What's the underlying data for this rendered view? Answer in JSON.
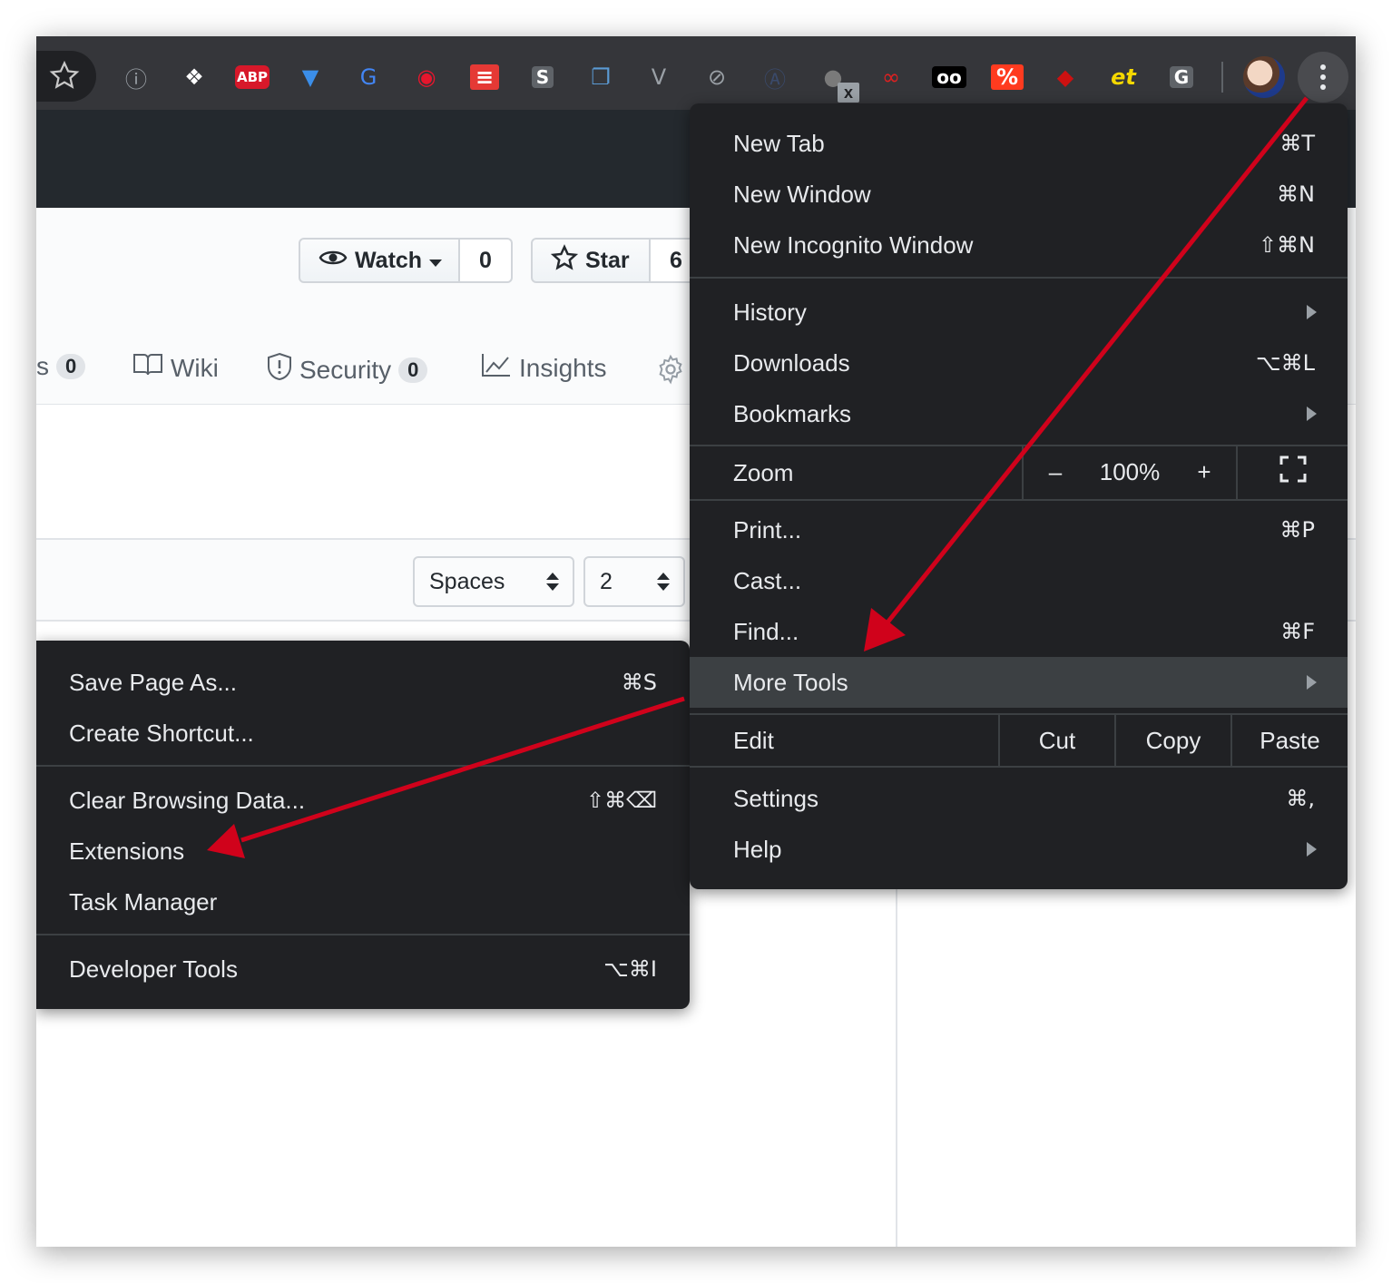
{
  "repo": {
    "watch_label": "Watch",
    "watch_count": "0",
    "star_label": "Star",
    "star_count": "6",
    "tabs": [
      {
        "label": "s",
        "count": "0"
      },
      {
        "label": "Wiki"
      },
      {
        "label": "Security",
        "count": "0"
      },
      {
        "label": "Insights"
      }
    ],
    "indent_mode": "Spaces",
    "indent_size": "2"
  },
  "toolbar": {
    "extensions": [
      {
        "icon": "info-circle-icon",
        "glyph": "ⓘ",
        "color": "#9aa0a6"
      },
      {
        "icon": "diamond-grid-icon",
        "glyph": "❖",
        "color": "#ffffff"
      },
      {
        "icon": "abp-icon",
        "glyph": "ABP",
        "color": "#d7182a"
      },
      {
        "icon": "gem-shield-icon",
        "glyph": "▼",
        "color": "#3b8ee8"
      },
      {
        "icon": "translate-icon",
        "glyph": "G",
        "color": "#4285f4"
      },
      {
        "icon": "weibo-icon",
        "glyph": "◉",
        "color": "#e6162d"
      },
      {
        "icon": "red-notes-icon",
        "glyph": "≡",
        "color": "#e53935"
      },
      {
        "icon": "s-box-icon",
        "glyph": "S",
        "color": "#8d8d8d"
      },
      {
        "icon": "windows-stack-icon",
        "glyph": "❐",
        "color": "#5b9bd5"
      },
      {
        "icon": "vue-icon",
        "glyph": "V",
        "color": "#9aa0a6"
      },
      {
        "icon": "block-icon",
        "glyph": "⊘",
        "color": "#9aa0a6"
      },
      {
        "icon": "a-circle-icon",
        "glyph": "Ⓐ",
        "color": "#3a4a6b"
      },
      {
        "icon": "egg-icon",
        "glyph": "●",
        "color": "#7a7a7a"
      },
      {
        "icon": "red-infinity-icon",
        "glyph": "∞",
        "color": "#e02020"
      },
      {
        "icon": "spy-glasses-icon",
        "glyph": "oo",
        "color": "#ffffff"
      },
      {
        "icon": "percent-tag-icon",
        "glyph": "%",
        "color": "#ff3b1f"
      },
      {
        "icon": "ruby-icon",
        "glyph": "◆",
        "color": "#cc1111"
      },
      {
        "icon": "et-icon",
        "glyph": "et",
        "color": "#f5d800"
      },
      {
        "icon": "g-box-icon",
        "glyph": "G",
        "color": "#c8c8c8"
      }
    ],
    "badge": "x"
  },
  "main_menu": {
    "items": [
      {
        "label": "New Tab",
        "shortcut": "⌘T"
      },
      {
        "label": "New Window",
        "shortcut": "⌘N"
      },
      {
        "label": "New Incognito Window",
        "shortcut": "⇧⌘N"
      },
      {
        "label": "History"
      },
      {
        "label": "Downloads",
        "shortcut": "⌥⌘L"
      },
      {
        "label": "Bookmarks"
      },
      {
        "label": "Print...",
        "shortcut": "⌘P"
      },
      {
        "label": "Cast..."
      },
      {
        "label": "Find...",
        "shortcut": "⌘F"
      },
      {
        "label": "More Tools"
      },
      {
        "label": "Settings",
        "shortcut": "⌘,"
      },
      {
        "label": "Help"
      }
    ],
    "zoom": {
      "label": "Zoom",
      "minus": "–",
      "value": "100%",
      "plus": "+"
    },
    "edit": {
      "label": "Edit",
      "cut": "Cut",
      "copy": "Copy",
      "paste": "Paste"
    }
  },
  "more_tools_menu": {
    "items": [
      {
        "label": "Save Page As...",
        "shortcut": "⌘S"
      },
      {
        "label": "Create Shortcut..."
      },
      {
        "label": "Clear Browsing Data...",
        "shortcut": "⇧⌘⌫"
      },
      {
        "label": "Extensions"
      },
      {
        "label": "Task Manager"
      },
      {
        "label": "Developer Tools",
        "shortcut": "⌥⌘I"
      }
    ]
  },
  "colors": {
    "annotation_arrow": "#d0021b",
    "menu_bg": "#202124",
    "toolbar_bg": "#35363a"
  }
}
